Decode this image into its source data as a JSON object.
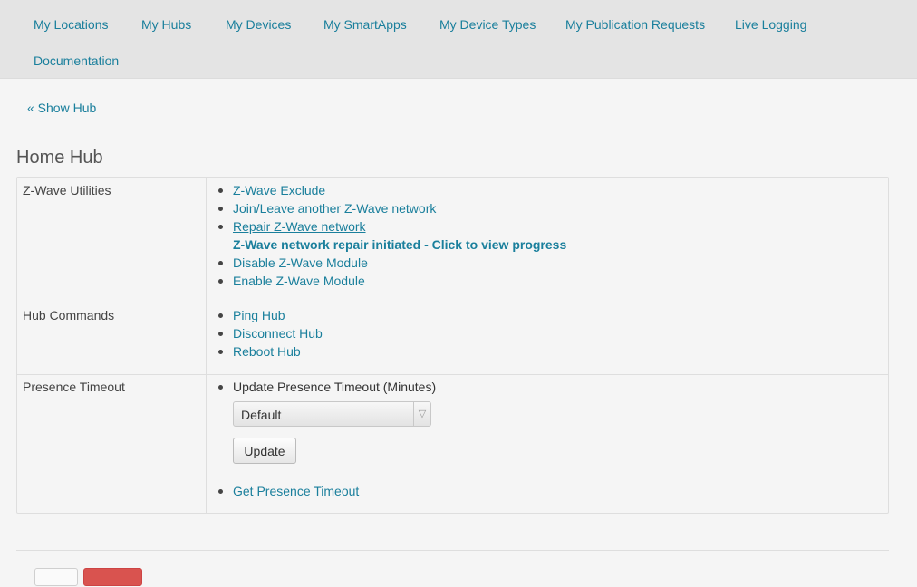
{
  "nav": {
    "items": [
      "My Locations",
      "My Hubs",
      "My Devices",
      "My SmartApps",
      "My Device Types",
      "My Publication Requests",
      "Live Logging",
      "Documentation"
    ]
  },
  "back_link": "« Show Hub",
  "page_title": "Home Hub",
  "zwave": {
    "label": "Z-Wave Utilities",
    "items": [
      "Z-Wave Exclude",
      "Join/Leave another Z-Wave network",
      "Repair Z-Wave network",
      "Disable Z-Wave Module",
      "Enable Z-Wave Module"
    ],
    "status": "Z-Wave network repair initiated - Click to view progress"
  },
  "hub_commands": {
    "label": "Hub Commands",
    "items": [
      "Ping Hub",
      "Disconnect Hub",
      "Reboot Hub"
    ]
  },
  "presence": {
    "label": "Presence Timeout",
    "update_label": "Update Presence Timeout (Minutes)",
    "select_value": "Default",
    "update_button": "Update",
    "get_link": "Get Presence Timeout"
  },
  "colors": {
    "link": "#1a7f9c",
    "nav_bg": "#e4e4e4",
    "danger": "#d9534f"
  }
}
